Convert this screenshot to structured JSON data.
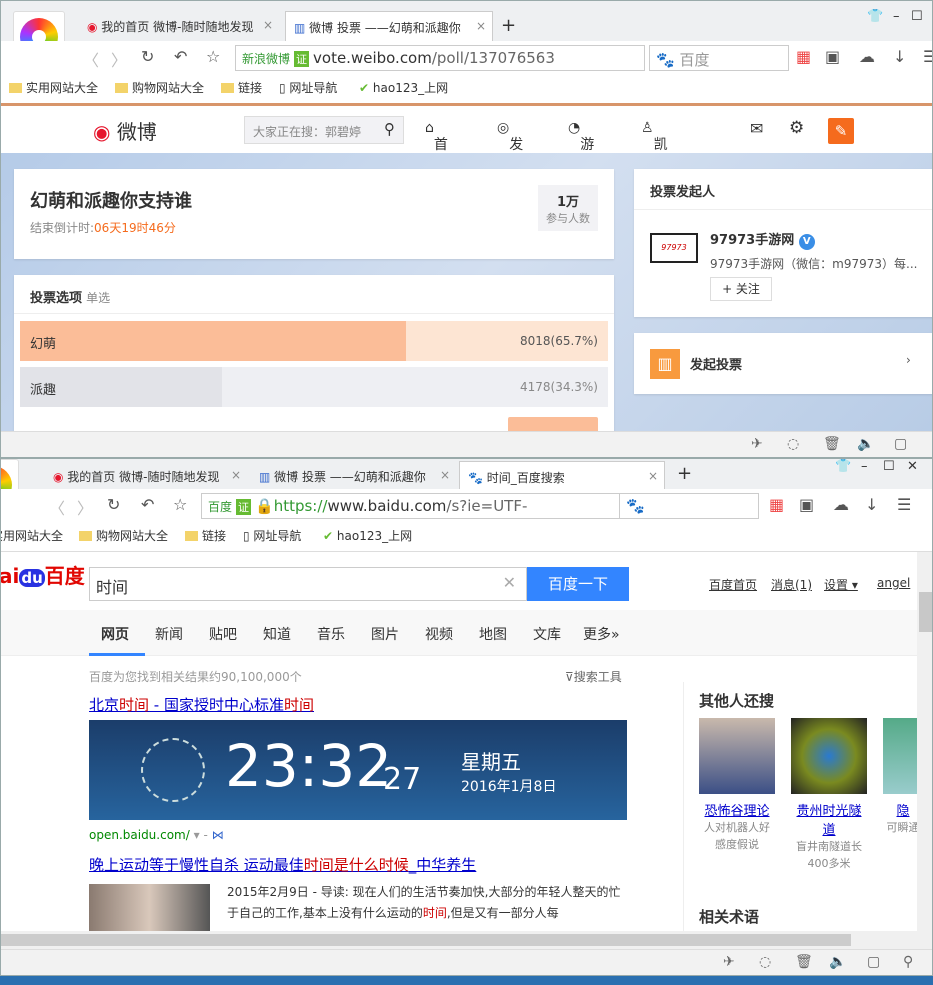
{
  "win1": {
    "tabs": [
      {
        "label": "我的首页 微博-随时随地发现"
      },
      {
        "label": "微博 投票 ——幻萌和派趣你"
      }
    ],
    "address": {
      "site_badge": "新浪微博",
      "cert": "证",
      "url_host": "vote.weibo.com",
      "url_path": "/poll/137076563"
    },
    "search_engine": "百度",
    "bookmarks": [
      "实用网站大全",
      "购物网站大全",
      "链接",
      "网址导航",
      "hao123_上网"
    ],
    "weibo_nav": {
      "logo": "微博",
      "search_placeholder": "大家正在搜：郭碧婷",
      "items": [
        "首页",
        "发现",
        "游戏",
        "凯文..."
      ]
    },
    "poll": {
      "title": "幻萌和派趣你支持谁",
      "countdown_label": "结束倒计时:",
      "countdown": "06天19时46分",
      "participants": "1万",
      "participants_label": "参与人数",
      "options_title": "投票选项",
      "options_mode": "单选",
      "options": [
        {
          "label": "幻萌",
          "result": "8018(65.7%)",
          "percent": 65.7
        },
        {
          "label": "派趣",
          "result": "4178(34.3%)",
          "percent": 34.3
        }
      ]
    },
    "initiator": {
      "title": "投票发起人",
      "name": "97973手游网",
      "desc": "97973手游网（微信：m97973）每...",
      "follow": "+ 关注",
      "logo_text": "97973"
    },
    "create_poll": "发起投票"
  },
  "win2": {
    "tabs": [
      {
        "label": "我的首页 微博-随时随地发现"
      },
      {
        "label": "微博 投票 ——幻萌和派趣你"
      },
      {
        "label": "时间_百度搜索"
      }
    ],
    "address": {
      "site_badge": "百度",
      "cert": "证",
      "url_scheme": "https://",
      "url_host": "www.baidu.com",
      "url_path": "/s?ie=UTF-"
    },
    "bookmarks": [
      "实用网站大全",
      "购物网站大全",
      "链接",
      "网址导航",
      "hao123_上网"
    ],
    "baidu": {
      "logo_a": "ai",
      "logo_b": "du",
      "logo_c": "百度",
      "query": "时间",
      "search_button": "百度一下",
      "top_links": [
        "百度首页",
        "消息(1)",
        "设置",
        "angel"
      ],
      "tabs": [
        "网页",
        "新闻",
        "贴吧",
        "知道",
        "音乐",
        "图片",
        "视频",
        "地图",
        "文库",
        "更多»"
      ],
      "result_count": "百度为您找到相关结果约90,100,000个",
      "tools": "搜索工具",
      "result1": {
        "title_parts": [
          "北京",
          "时间",
          " - 国家授时中心标准",
          "时间"
        ],
        "time": "23:32",
        "seconds": "27",
        "weekday": "星期五",
        "date": "2016年1月8日",
        "url": "open.baidu.com/"
      },
      "result2": {
        "title_a": "晚上运动等于慢性自杀 运动最佳",
        "title_b": "时间是什么时候",
        "title_c": "_中华养生",
        "snippet_a": "2015年2月9日 - 导读: 现在人们的生活节奏加快,大部分的年轻人整天的忙于自己的工作,基本上没有什么运动的",
        "snippet_hl": "时间",
        "snippet_b": ",但是又有一部分人每"
      },
      "side": {
        "title": "其他人还搜",
        "items": [
          {
            "name": "恐怖谷理论",
            "desc": "人对机器人好感度假说"
          },
          {
            "name": "贵州时光隧道",
            "desc": "盲井南隧道长400多米"
          },
          {
            "name": "隐",
            "desc": "可瞬通"
          }
        ],
        "related": "相关术语"
      }
    }
  }
}
